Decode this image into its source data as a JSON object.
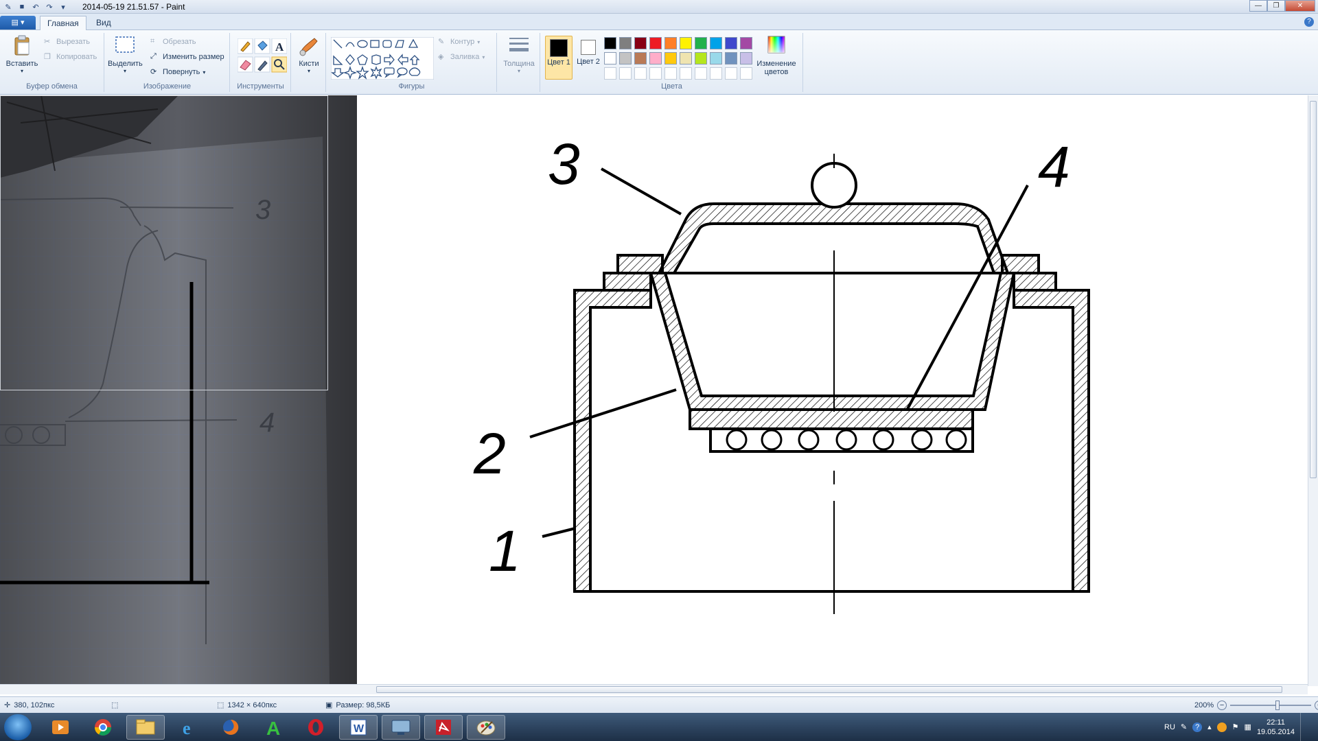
{
  "window": {
    "title": "2014-05-19 21.51.57 - Paint"
  },
  "tabs": {
    "home": "Главная",
    "view": "Вид"
  },
  "ribbon": {
    "clipboard": {
      "label": "Буфер обмена",
      "paste": "Вставить",
      "cut": "Вырезать",
      "copy": "Копировать"
    },
    "image": {
      "label": "Изображение",
      "select": "Выделить",
      "crop": "Обрезать",
      "resize": "Изменить размер",
      "rotate": "Повернуть"
    },
    "tools": {
      "label": "Инструменты"
    },
    "brushes": {
      "label": "Кисти"
    },
    "shapes": {
      "label": "Фигуры",
      "outline": "Контур",
      "fill": "Заливка"
    },
    "size": {
      "label": "Толщина"
    },
    "colors": {
      "label": "Цвета",
      "color1": "Цвет 1",
      "color2": "Цвет 2",
      "edit": "Изменение цветов",
      "palette": [
        "#000000",
        "#7f7f7f",
        "#880015",
        "#ed1c24",
        "#ff7f27",
        "#fff200",
        "#22b14c",
        "#00a2e8",
        "#3f48cc",
        "#a349a4",
        "#ffffff",
        "#c3c3c3",
        "#b97a57",
        "#ffaec9",
        "#ffc90e",
        "#efe4b0",
        "#b5e61d",
        "#99d9ea",
        "#7092be",
        "#c8bfe7"
      ]
    }
  },
  "drawing": {
    "labels": [
      "1",
      "2",
      "3",
      "4"
    ]
  },
  "photo": {
    "labels": [
      "3",
      "4"
    ]
  },
  "status": {
    "cursor": "380, 102пкс",
    "dimensions": "1342 × 640пкс",
    "filesize": "Размер: 98,5КБ",
    "zoom": "200%"
  },
  "taskbar": {
    "lang": "RU",
    "time": "22:11",
    "date": "19.05.2014"
  }
}
